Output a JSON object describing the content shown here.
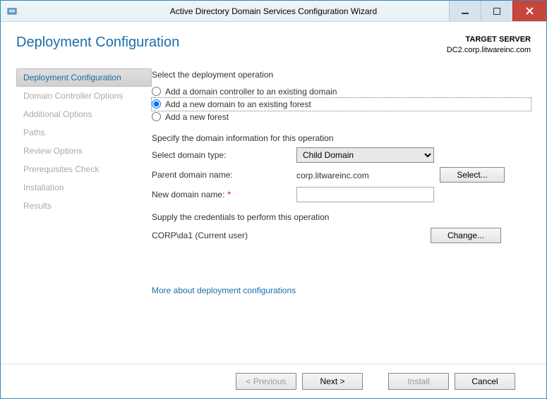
{
  "window": {
    "title": "Active Directory Domain Services Configuration Wizard"
  },
  "header": {
    "page_title": "Deployment Configuration",
    "target_label": "TARGET SERVER",
    "target_value": "DC2.corp.litwareinc.com"
  },
  "sidebar": {
    "items": [
      {
        "label": "Deployment Configuration"
      },
      {
        "label": "Domain Controller Options"
      },
      {
        "label": "Additional Options"
      },
      {
        "label": "Paths"
      },
      {
        "label": "Review Options"
      },
      {
        "label": "Prerequisites Check"
      },
      {
        "label": "Installation"
      },
      {
        "label": "Results"
      }
    ],
    "active_index": 0
  },
  "main": {
    "section1_label": "Select the deployment operation",
    "radios": [
      {
        "label": "Add a domain controller to an existing domain"
      },
      {
        "label": "Add a new domain to an existing forest"
      },
      {
        "label": "Add a new forest"
      }
    ],
    "selected_radio": 1,
    "section2_label": "Specify the domain information for this operation",
    "domain_type_label": "Select domain type:",
    "domain_type_value": "Child Domain",
    "parent_label": "Parent domain name:",
    "parent_value": "corp.litwareinc.com",
    "select_btn": "Select...",
    "new_domain_label": "New domain name:",
    "new_domain_value": "",
    "section3_label": "Supply the credentials to perform this operation",
    "current_user": "CORP\\da1 (Current user)",
    "change_btn": "Change...",
    "more_link": "More about deployment configurations"
  },
  "footer": {
    "previous": "< Previous",
    "next": "Next >",
    "install": "Install",
    "cancel": "Cancel"
  }
}
